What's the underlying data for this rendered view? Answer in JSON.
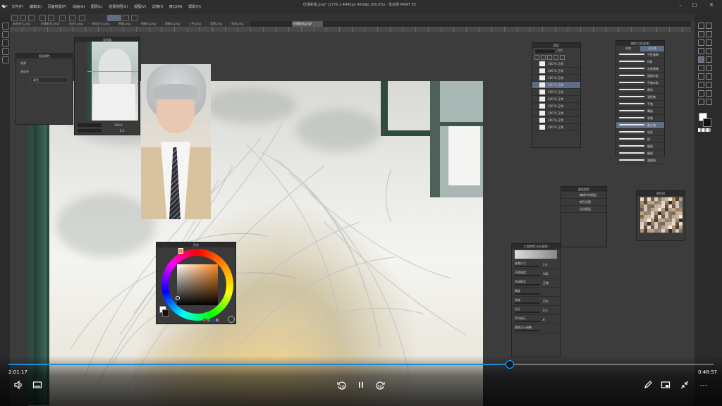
{
  "app": {
    "window_title": "仿课彩铅.png* (2770 x 4445px 450dpi 100.0%) - 优动漫 PAINT EX",
    "menu": [
      "文件(F)",
      "编辑(E)",
      "页面管理(P)",
      "动画(A)",
      "图层(L)",
      "选择范围(S)",
      "视图(V)",
      "滤镜(I)",
      "窗口(W)",
      "帮助(H)"
    ],
    "tabs": [
      "未命名-1.png",
      "仿课彩铅.png*",
      "花卉1.png",
      "未命名-2.png",
      "草稿.png",
      "线稿-1.png",
      "线稿-2.png",
      "上色.png",
      "背景.png",
      "完成.png",
      "仿课彩铅.png*"
    ],
    "active_tab_index": 10
  },
  "panels": {
    "navigator": {
      "title": "导航器",
      "zoom": "100.0",
      "rotate": "0.0"
    },
    "layer_property": {
      "title": "图层属性",
      "row1": "效果",
      "row2": "表现色",
      "color_value": "彩色"
    },
    "layers": {
      "title": "图层",
      "opacity": "100",
      "rows": [
        {
          "label": "100 % 正常",
          "sub": "图层 1",
          "selected": false
        },
        {
          "label": "100 % 正常",
          "sub": "图层 2",
          "selected": false
        },
        {
          "label": "100 % 正常",
          "sub": "图层 3",
          "selected": false
        },
        {
          "label": "100 % 正常",
          "sub": "图层 4",
          "selected": true
        },
        {
          "label": "100 % 正常",
          "sub": "图层 5",
          "selected": false
        },
        {
          "label": "100 % 正常",
          "sub": "图层 6",
          "selected": false
        },
        {
          "label": "100 % 正常",
          "sub": "图层 7",
          "selected": false
        },
        {
          "label": "100 % 正常",
          "sub": "图层 8",
          "selected": false
        },
        {
          "label": "100 % 正常",
          "sub": "图层 9",
          "selected": false
        },
        {
          "label": "100 % 正常",
          "sub": "图层 10",
          "selected": false
        }
      ]
    },
    "subtools": {
      "title": "辅助工具[画笔]",
      "tabs": [
        "毛笔",
        "水彩笔"
      ],
      "items": [
        "干性笔刷",
        "G笔",
        "水彩画笔",
        "湿润水彩",
        "平笔水彩",
        "厚涂",
        "混色笔",
        "平笔",
        "晕染",
        "毛笔",
        "墨水笔",
        "淡彩",
        "线",
        "粗线",
        "细线",
        "渐变线"
      ],
      "selected_index": 10
    },
    "tool_property": {
      "title": "工具属性[水彩画笔]",
      "rows": [
        {
          "label": "画笔尺寸",
          "value": "3.4"
        },
        {
          "label": "不透明度",
          "value": "100"
        },
        {
          "label": "合成模式",
          "value": "正常"
        },
        {
          "label": "硬度",
          "value": ""
        },
        {
          "label": "浓度",
          "value": "250"
        },
        {
          "label": "水分",
          "value": "0.0"
        },
        {
          "label": "手抖修正",
          "value": "8"
        },
        {
          "label": "笔刷大小调整",
          "value": ""
        }
      ]
    },
    "layer_search": {
      "title": "图层搜索",
      "rows": [
        "编辑中的图层",
        "颜色设置",
        "全选图层"
      ]
    },
    "color_wheel": {
      "title": "色轮",
      "fg_color": "#ffffff",
      "bg_color": "#111111",
      "hue_color": "#ff8a1e"
    },
    "color_set": {
      "title": "颜色组"
    }
  },
  "video": {
    "current_time": "2:01:17",
    "remaining_time": "0:48:57",
    "progress": 0.711,
    "buttons": {
      "volume": "volume-icon",
      "subtitles": "subtitles-icon",
      "rewind": "10",
      "forward": "30",
      "pen": "pen-icon",
      "minimode": "minimode-icon",
      "exit_fullscreen": "exit-fullscreen-icon",
      "more": "more-icon"
    },
    "accent_color": "#1c8bd8"
  }
}
